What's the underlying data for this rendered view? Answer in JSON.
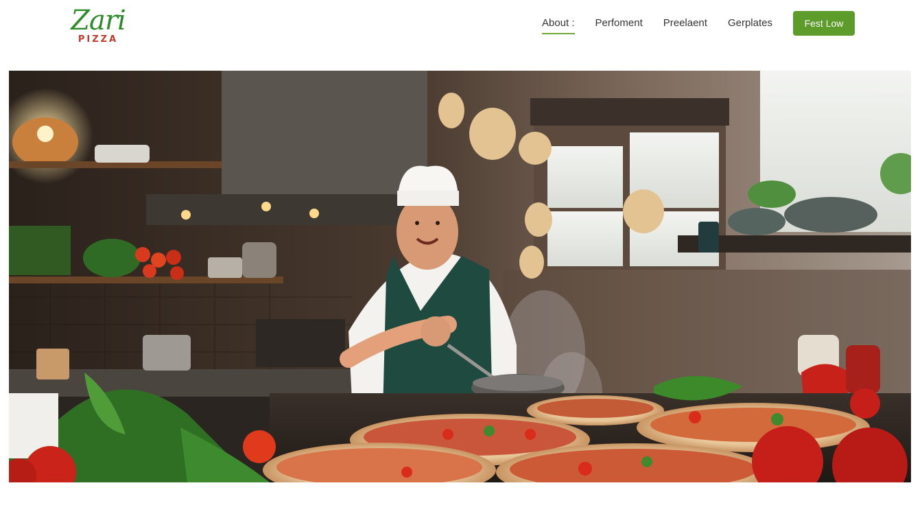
{
  "brand": {
    "name": "Zari",
    "tagline": "PIZZA",
    "primary_color": "#5d9c2a",
    "accent_color": "#c0392b"
  },
  "nav": {
    "items": [
      {
        "label": "About :",
        "active": true
      },
      {
        "label": "Perfoment",
        "active": false
      },
      {
        "label": "Preelaent",
        "active": false
      },
      {
        "label": "Gerplates",
        "active": false
      }
    ],
    "cta_label": "Fest Low"
  },
  "hero": {
    "image": "chef tossing dough in a kitchen with pizzas on the counter"
  }
}
